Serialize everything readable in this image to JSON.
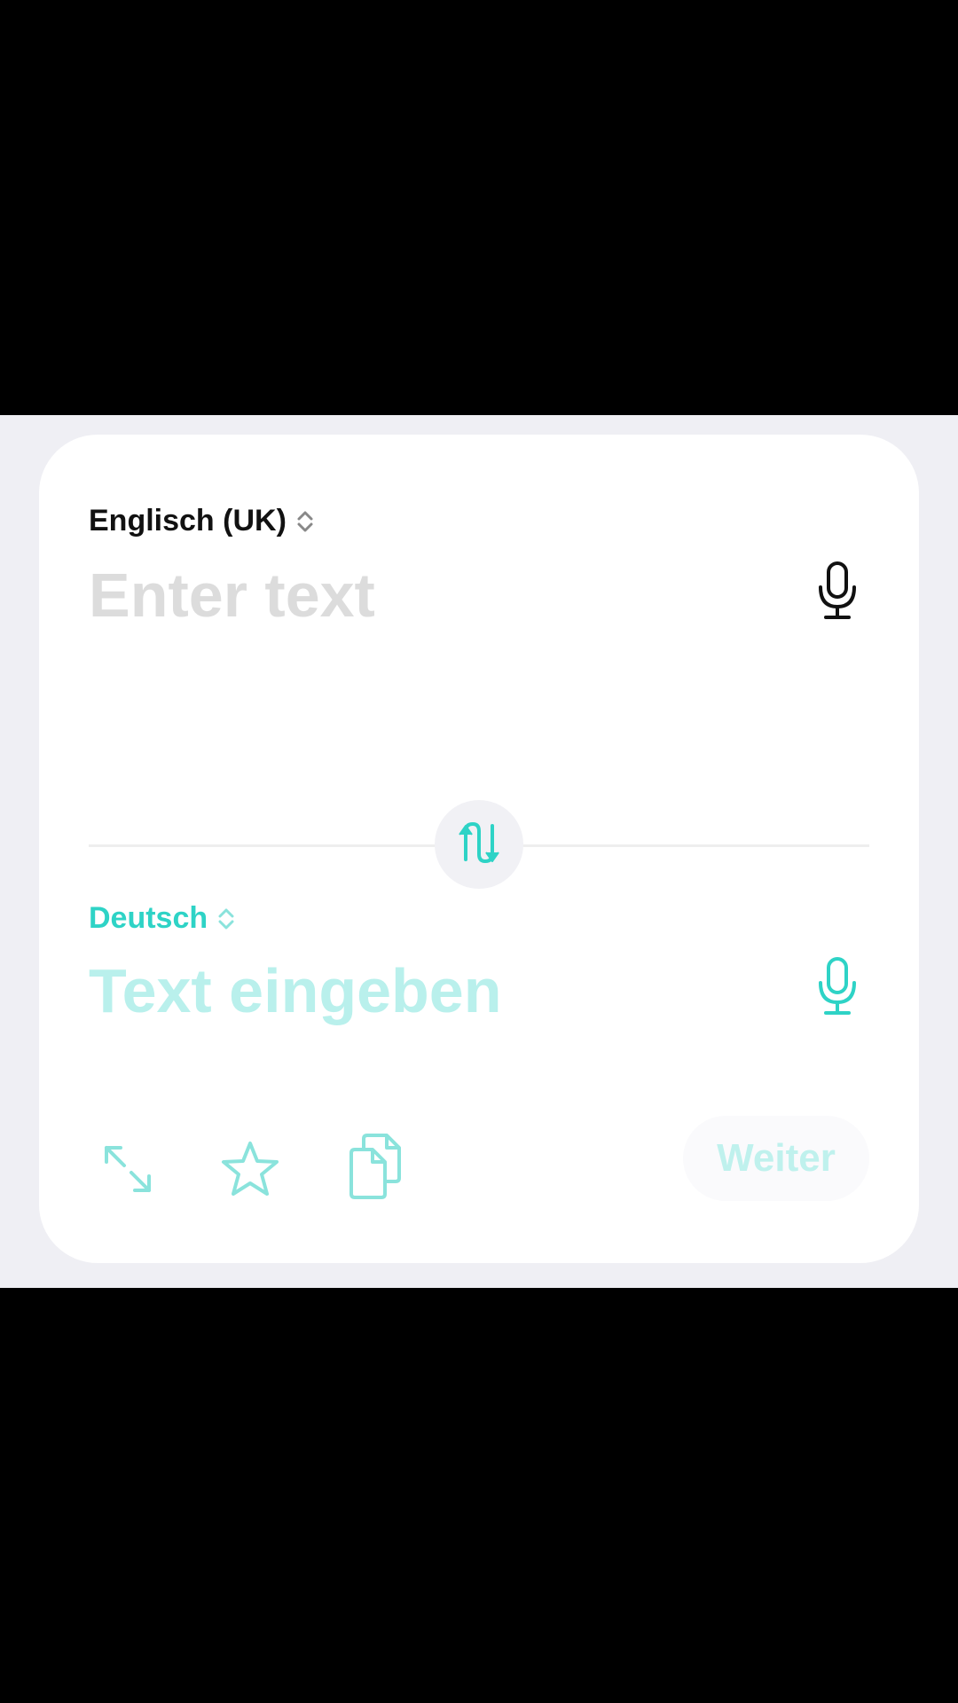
{
  "source": {
    "language_label": "Englisch (UK)",
    "placeholder": "Enter text",
    "value": ""
  },
  "target": {
    "language_label": "Deutsch",
    "placeholder": "Text eingeben",
    "value": ""
  },
  "actions": {
    "next_label": "Weiter"
  },
  "icons": {
    "source_mic": "microphone-icon",
    "target_mic": "microphone-icon",
    "swap": "swap-arrows-icon",
    "expand": "expand-icon",
    "favorite": "star-icon",
    "paste": "paste-documents-icon",
    "language_chooser": "chevron-up-down-icon"
  },
  "colors": {
    "accent": "#2ed3c6",
    "accent_light": "#b9f0ec",
    "background": "#efeff4",
    "card": "#ffffff",
    "text_dark": "#111111",
    "placeholder_gray": "#dcdcdc"
  }
}
